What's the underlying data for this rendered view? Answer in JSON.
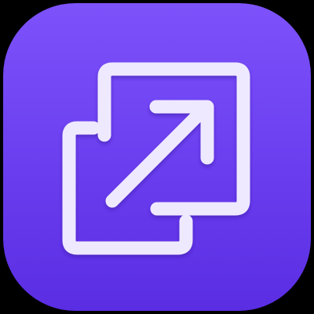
{
  "app_icon": {
    "name": "open-external-link-icon",
    "colors": {
      "background": "#000000",
      "tile": "#6a3df4",
      "tile_highlight": "#7d52fb",
      "tile_shadow": "#5a2de3",
      "glyph": "#efe9ff",
      "glyph_shadow": "#b7a2ff"
    }
  }
}
